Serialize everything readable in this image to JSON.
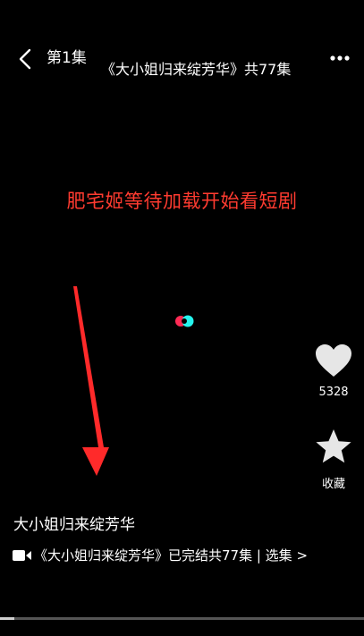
{
  "header": {
    "episode_label": "第1集",
    "series_title": "《大小姐归来绽芳华》共77集"
  },
  "overlay": {
    "text": "肥宅姬等待加载开始看短剧",
    "color": "#ff3b30"
  },
  "actions": {
    "like_count": "5328",
    "favorite_label": "收藏"
  },
  "bottom": {
    "drama_name": "大小姐归来绽芳华",
    "info_text": "《大小姐归来绽芳华》已完结共77集 | 选集 >"
  },
  "icons": {
    "back": "back-chevron-icon",
    "more": "more-dots-icon",
    "like": "heart-icon",
    "favorite": "star-icon",
    "video": "video-camera-icon"
  },
  "colors": {
    "background": "#000000",
    "loading_red": "#ff2b55",
    "loading_cyan": "#25f4ee",
    "icon_gray": "#e6e6e6"
  },
  "progress": {
    "fraction": 0.04
  }
}
